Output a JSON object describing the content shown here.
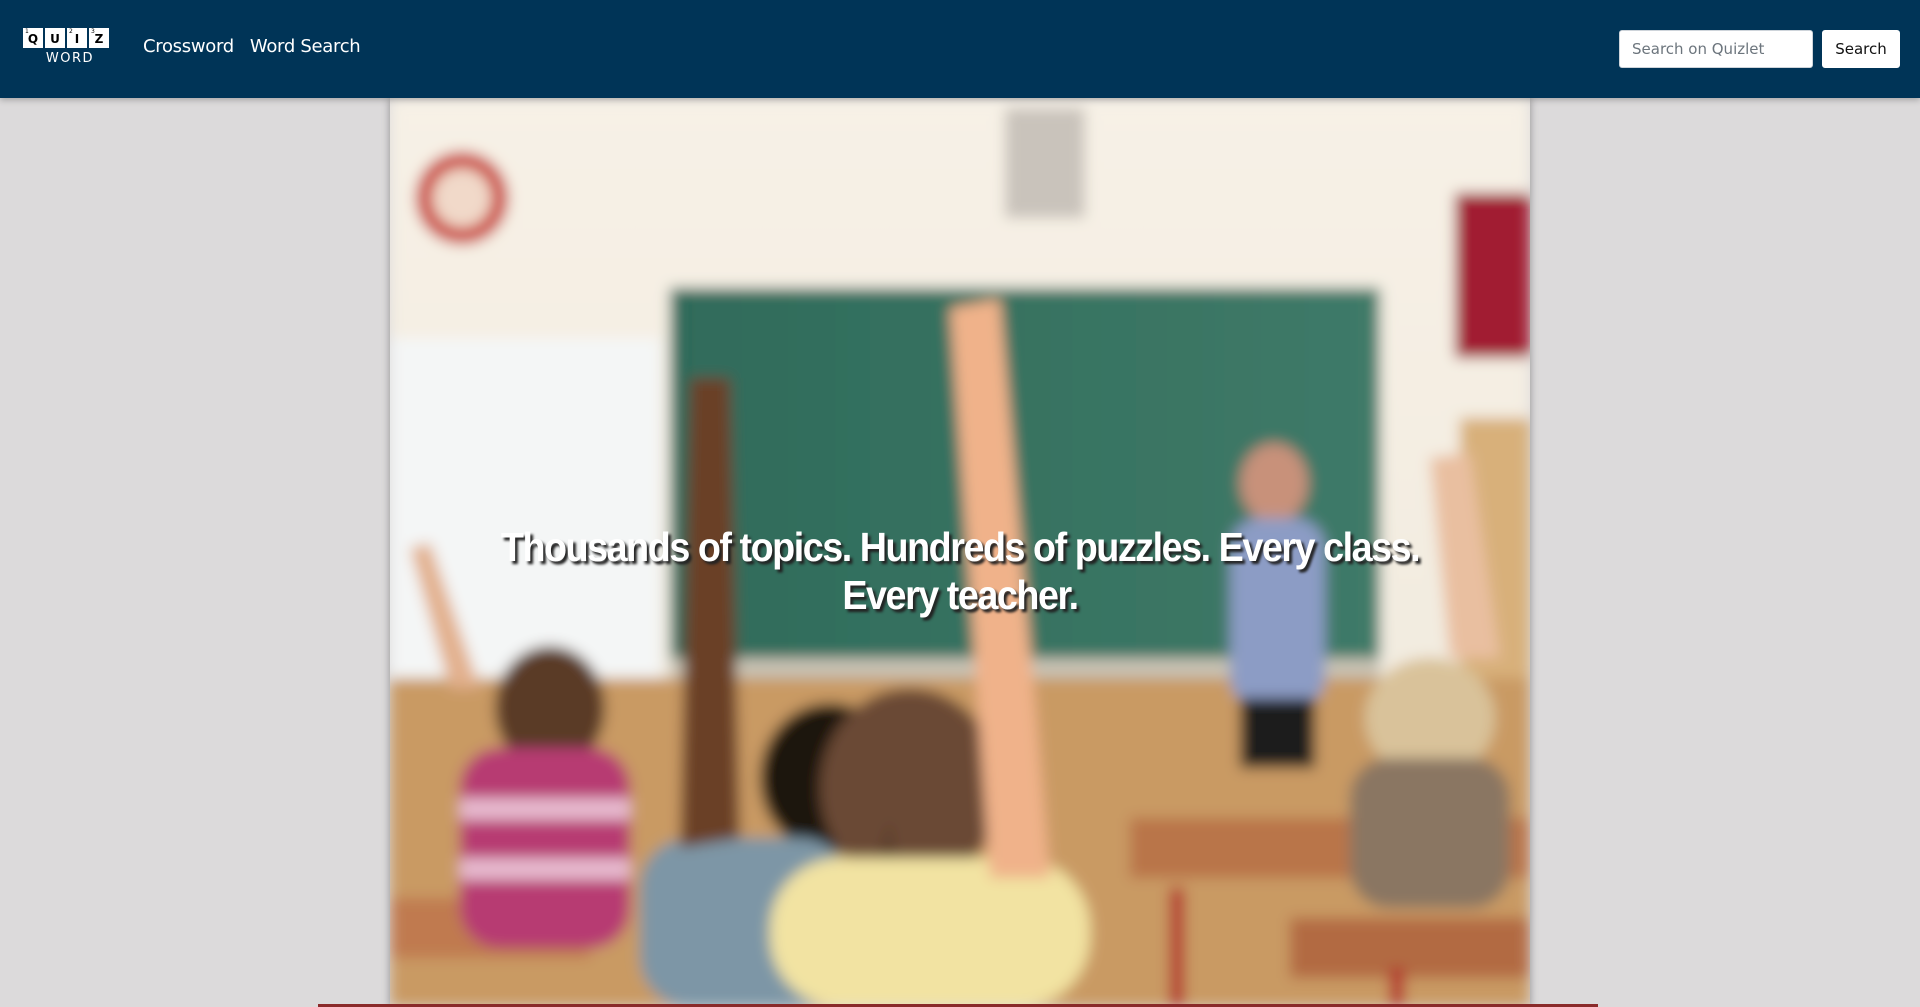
{
  "navbar": {
    "logo": {
      "tiles": [
        {
          "num": "1",
          "letter": "Q"
        },
        {
          "num": "",
          "letter": "U"
        },
        {
          "num": "2",
          "letter": "I"
        },
        {
          "num": "3",
          "letter": "Z"
        }
      ],
      "word": "WORD"
    },
    "links": [
      "Crossword",
      "Word Search"
    ],
    "search": {
      "placeholder": "Search on Quizlet",
      "value": "",
      "button_label": "Search"
    }
  },
  "hero": {
    "heading": "Thousands of topics. Hundreds of puzzles. Every class. Every teacher."
  },
  "colors": {
    "navbar_bg": "#003457",
    "page_bg": "#dcdadb",
    "footer_line": "#8a2a2a"
  }
}
